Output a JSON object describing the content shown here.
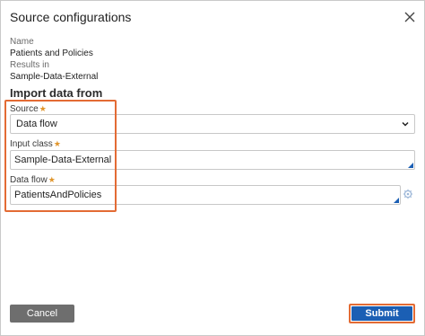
{
  "dialog": {
    "title": "Source configurations",
    "close_icon": "close-icon"
  },
  "meta": {
    "name_label": "Name",
    "name_value": "Patients and Policies",
    "results_label": "Results in",
    "results_value": "Sample-Data-External"
  },
  "section": {
    "heading": "Import data from"
  },
  "fields": {
    "source": {
      "label": "Source",
      "required_mark": "★",
      "value": "Data flow"
    },
    "input_class": {
      "label": "Input class",
      "required_mark": "★",
      "value": "Sample-Data-External"
    },
    "data_flow": {
      "label": "Data flow",
      "required_mark": "★",
      "value": "PatientsAndPolicies"
    }
  },
  "footer": {
    "cancel_label": "Cancel",
    "submit_label": "Submit"
  },
  "colors": {
    "accent": "#1b5fb4",
    "highlight": "#e36b34",
    "required": "#e0952b",
    "cancel_bg": "#6e6e6e"
  }
}
